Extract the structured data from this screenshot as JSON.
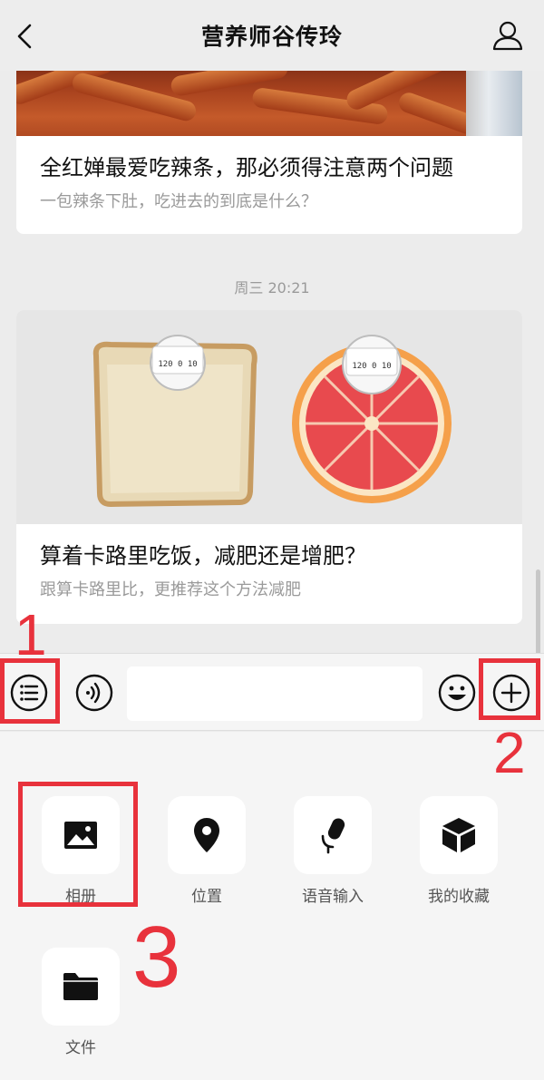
{
  "header": {
    "title": "营养师谷传玲",
    "back_icon": "chevron-left-icon",
    "profile_icon": "person-icon"
  },
  "messages": [
    {
      "title": "全红婵最爱吃辣条，那必须得注意两个问题",
      "subtitle": "一包辣条下肚，吃进去的到底是什么？"
    },
    {
      "timestamp": "周三 20:21",
      "title": "算着卡路里吃饭，减肥还是增肥？",
      "subtitle": "跟算卡路里比，更推荐这个方法减肥",
      "scale_label": "120 0 10"
    }
  ],
  "input_bar": {
    "menu_icon": "list-menu-icon",
    "voice_icon": "voice-icon",
    "text_value": "",
    "emoji_icon": "emoji-icon",
    "plus_icon": "plus-circle-icon"
  },
  "panel": {
    "items": [
      {
        "label": "相册",
        "icon": "photo-album-icon"
      },
      {
        "label": "位置",
        "icon": "location-pin-icon"
      },
      {
        "label": "语音输入",
        "icon": "microphone-icon"
      },
      {
        "label": "我的收藏",
        "icon": "favorites-cube-icon"
      },
      {
        "label": "文件",
        "icon": "folder-icon"
      }
    ]
  },
  "annotations": {
    "label_1": "1",
    "label_2": "2",
    "label_3": "3",
    "color": "#e8323c"
  }
}
